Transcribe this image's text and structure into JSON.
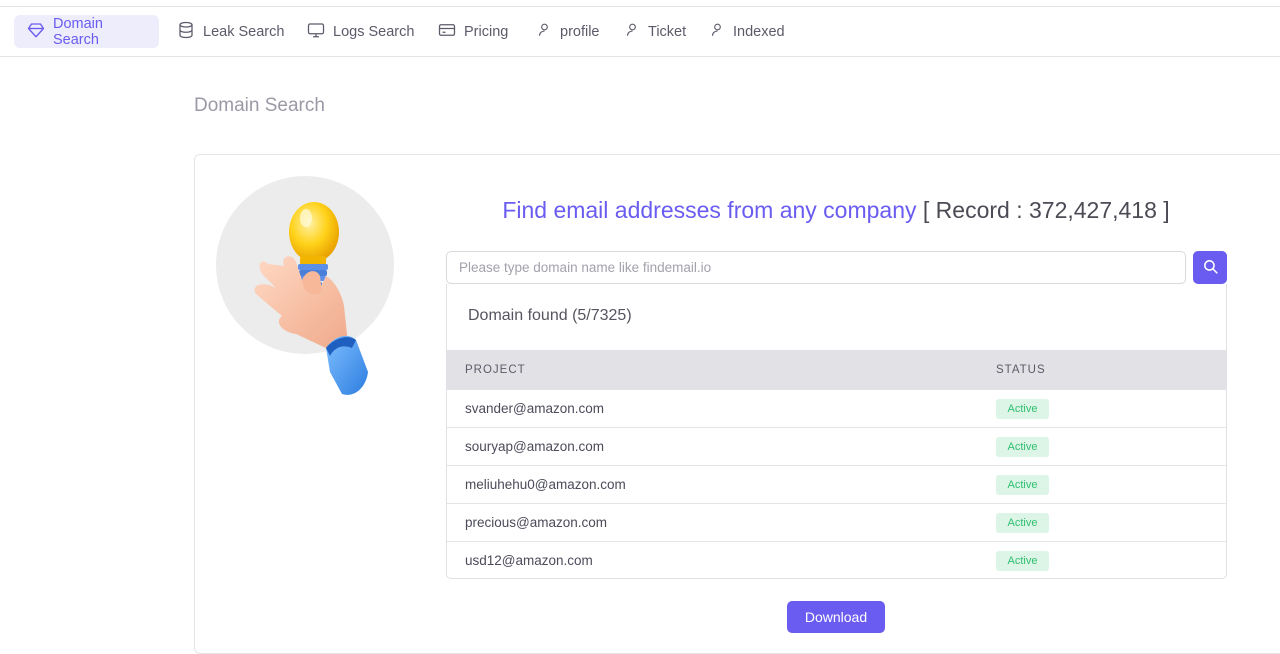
{
  "nav": {
    "items": [
      {
        "label": "Domain Search",
        "icon": "diamond-icon",
        "active": true
      },
      {
        "label": "Leak Search",
        "icon": "database-icon",
        "active": false
      },
      {
        "label": "Logs Search",
        "icon": "monitor-icon",
        "active": false
      },
      {
        "label": "Pricing",
        "icon": "credit-card-icon",
        "active": false
      },
      {
        "label": "profile",
        "icon": "user-icon",
        "active": false
      },
      {
        "label": "Ticket",
        "icon": "user-icon",
        "active": false
      },
      {
        "label": "Indexed",
        "icon": "user-icon",
        "active": false
      }
    ]
  },
  "page": {
    "title": "Domain Search"
  },
  "hero": {
    "headline_accent": "Find email addresses from any company",
    "headline_record": "[ Record : 372,427,418 ]"
  },
  "search": {
    "placeholder": "Please type domain name like findemail.io",
    "value": ""
  },
  "results": {
    "title": "Domain found (5/7325)",
    "columns": [
      "PROJECT",
      "STATUS"
    ],
    "rows": [
      {
        "email": "svander@amazon.com",
        "status": "Active"
      },
      {
        "email": "souryap@amazon.com",
        "status": "Active"
      },
      {
        "email": "meliuhehu0@amazon.com",
        "status": "Active"
      },
      {
        "email": "precious@amazon.com",
        "status": "Active"
      },
      {
        "email": "usd12@amazon.com",
        "status": "Active"
      }
    ]
  },
  "download": {
    "label": "Download"
  },
  "colors": {
    "accent": "#6a5cf0",
    "active_nav_bg": "#eeedfc",
    "badge_bg": "#dcf5e6",
    "badge_text": "#2fbf71"
  }
}
